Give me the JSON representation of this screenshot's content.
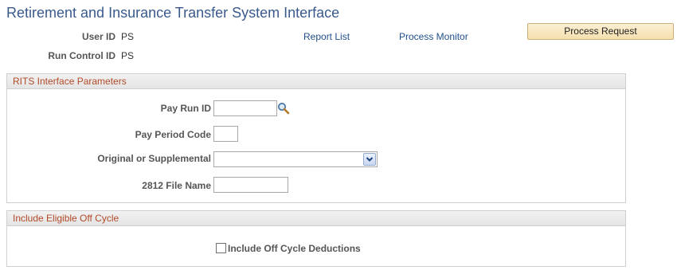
{
  "page": {
    "title": "Retirement and Insurance Transfer System Interface"
  },
  "header": {
    "user_id_label": "User ID",
    "user_id_value": "PS",
    "run_control_label": "Run Control ID",
    "run_control_value": "PS",
    "report_list_link": "Report List",
    "process_monitor_link": "Process Monitor",
    "process_request_button": "Process Request"
  },
  "rits_params": {
    "title": "RITS Interface Parameters",
    "pay_run_id": {
      "label": "Pay Run ID",
      "value": "",
      "icon": "lookup-icon"
    },
    "pay_period_code": {
      "label": "Pay Period Code",
      "value": ""
    },
    "original_or_supplemental": {
      "label": "Original or Supplemental",
      "selected": "",
      "icon": "chevron-down-icon"
    },
    "file_name_2812": {
      "label": "2812 File Name",
      "value": ""
    }
  },
  "off_cycle": {
    "title": "Include Eligible Off Cycle",
    "include_deductions": {
      "label": "Include Off Cycle Deductions",
      "checked": false
    }
  },
  "colors": {
    "title": "#3a5a8c",
    "group_title": "#b24a2a",
    "link": "#1f4f8c",
    "button_bg": "#f5dfae"
  }
}
